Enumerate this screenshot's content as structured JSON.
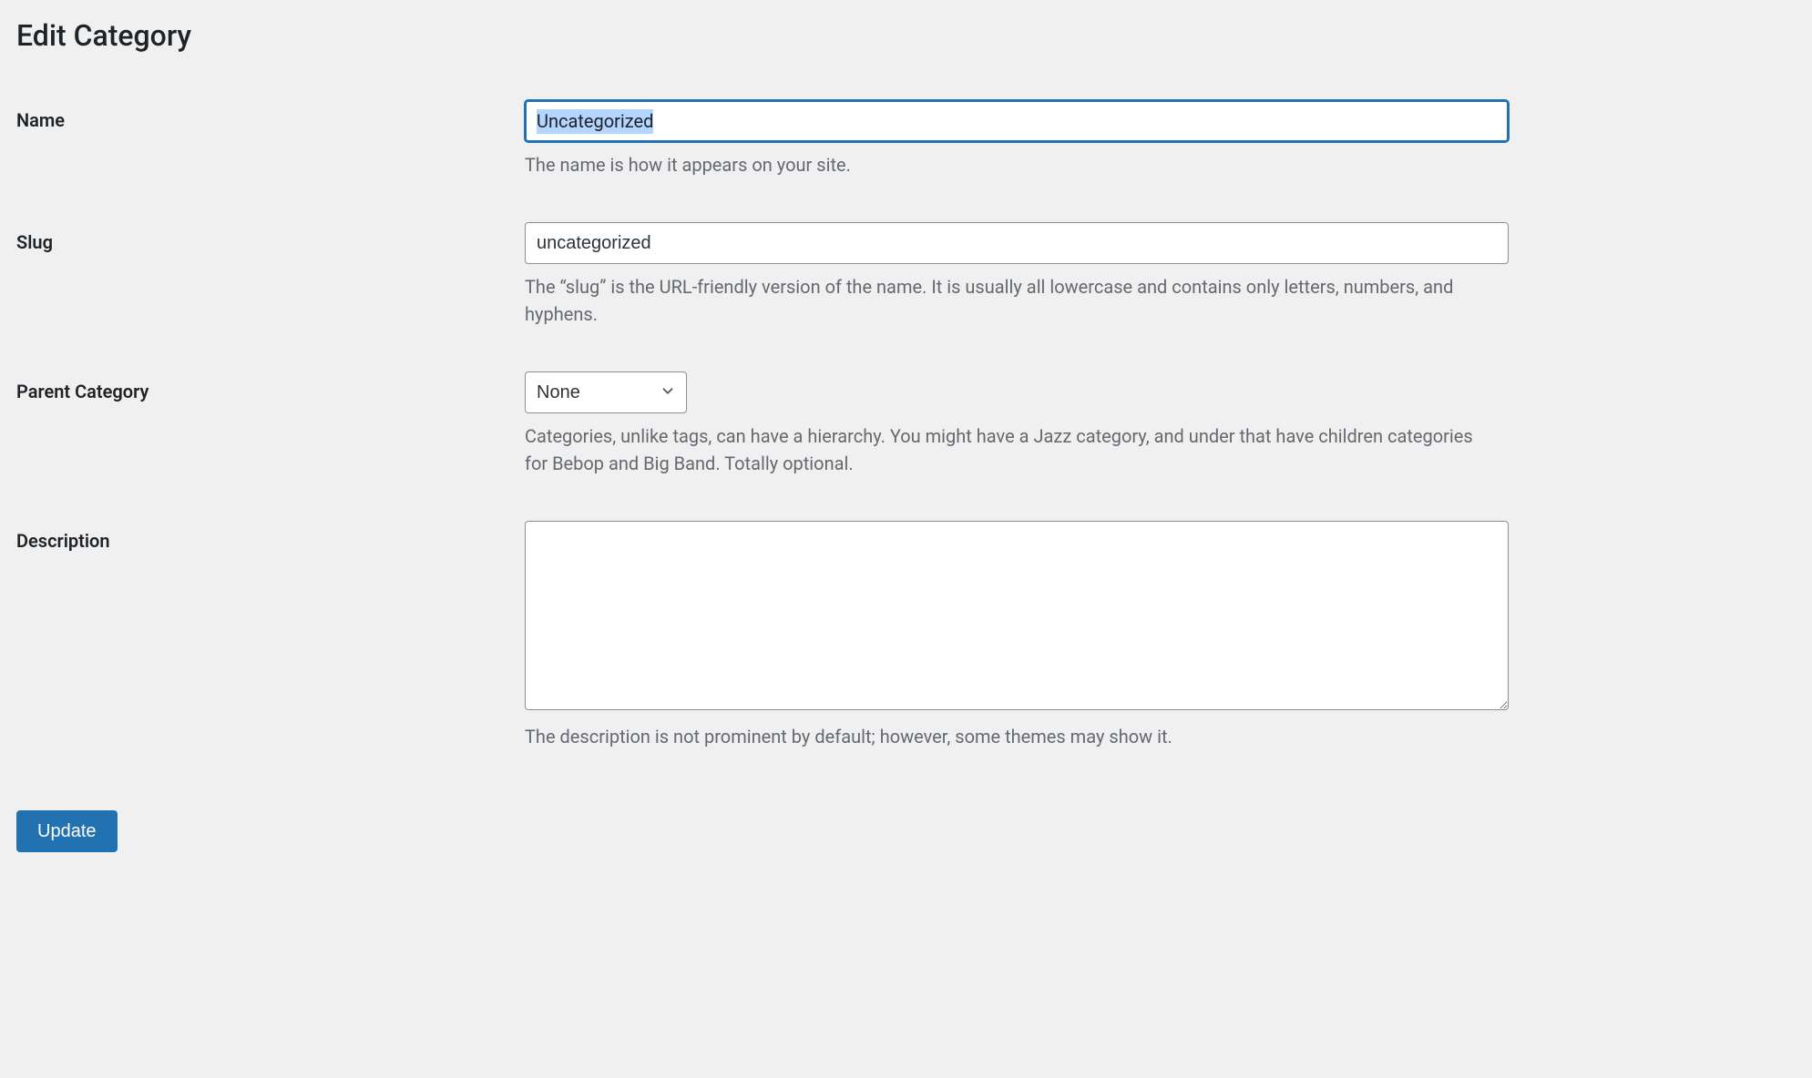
{
  "page": {
    "title": "Edit Category"
  },
  "fields": {
    "name": {
      "label": "Name",
      "value": "Uncategorized",
      "description": "The name is how it appears on your site."
    },
    "slug": {
      "label": "Slug",
      "value": "uncategorized",
      "description": "The “slug” is the URL-friendly version of the name. It is usually all lowercase and contains only letters, numbers, and hyphens."
    },
    "parent": {
      "label": "Parent Category",
      "value": "None",
      "description": "Categories, unlike tags, can have a hierarchy. You might have a Jazz category, and under that have children categories for Bebop and Big Band. Totally optional."
    },
    "description": {
      "label": "Description",
      "value": "",
      "description": "The description is not prominent by default; however, some themes may show it."
    }
  },
  "actions": {
    "update_label": "Update"
  }
}
